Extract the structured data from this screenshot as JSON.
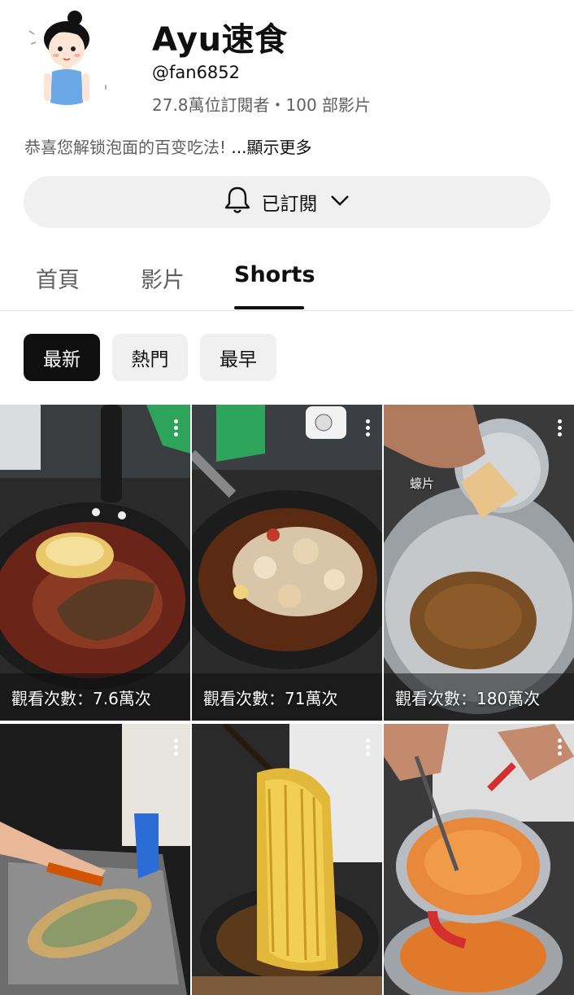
{
  "channel": {
    "name": "Ayu速食",
    "handle": "@fan6852",
    "stats": "27.8萬位訂閱者・100 部影片",
    "description": "恭喜您解锁泡面的百变吃法! ",
    "more": "...顯示更多"
  },
  "subscribe": {
    "label": "已訂閱",
    "icon": "bell-icon"
  },
  "tabs": [
    {
      "label": "首頁"
    },
    {
      "label": "影片"
    },
    {
      "label": "Shorts",
      "active": true
    }
  ],
  "chips": [
    {
      "label": "最新",
      "active": true
    },
    {
      "label": "熱門"
    },
    {
      "label": "最早"
    }
  ],
  "shorts": [
    {
      "views": "觀看次數：7.6萬次"
    },
    {
      "views": "觀看次數：71萬次"
    },
    {
      "views": "觀看次數：180萬次",
      "overlay_text": "蠔片"
    },
    {
      "views": ""
    },
    {
      "views": ""
    },
    {
      "views": ""
    }
  ]
}
